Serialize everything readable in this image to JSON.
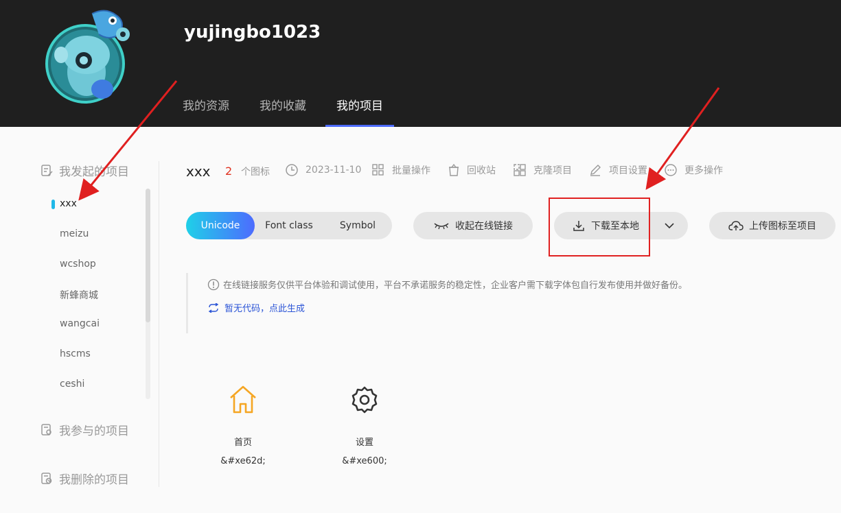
{
  "header": {
    "username": "yujingbo1023",
    "tabs": [
      {
        "label": "我的资源",
        "active": false
      },
      {
        "label": "我的收藏",
        "active": false
      },
      {
        "label": "我的项目",
        "active": true
      }
    ]
  },
  "sidebar": {
    "created_heading": "我发起的项目",
    "projects": [
      "xxx",
      "meizu",
      "wcshop",
      "新蜂商城",
      "wangcai",
      "hscms",
      "ceshi"
    ],
    "active_project": "xxx",
    "joined_heading": "我参与的项目",
    "deleted_heading": "我删除的项目"
  },
  "project": {
    "name": "xxx",
    "icon_count": "2",
    "icon_count_label": "个图标",
    "date": "2023-11-10",
    "actions": {
      "batch": "批量操作",
      "recycle": "回收站",
      "clone": "克隆项目",
      "settings": "项目设置",
      "more": "更多操作"
    }
  },
  "toolbar": {
    "formats": [
      "Unicode",
      "Font class",
      "Symbol"
    ],
    "active_format": "Unicode",
    "collapse_link": "收起在线链接",
    "download": "下载至本地",
    "upload": "上传图标至项目"
  },
  "notice": {
    "text": "在线链接服务仅供平台体验和调试使用，平台不承诺服务的稳定性，企业客户需下载字体包自行发布使用并做好备份。",
    "generate_link": "暂无代码，点此生成"
  },
  "glyphs": [
    {
      "name": "首页",
      "code": "&#xe62d;",
      "icon": "home-icon",
      "color": "#f5a623"
    },
    {
      "name": "设置",
      "code": "&#xe600;",
      "icon": "gear-icon",
      "color": "#333333"
    }
  ],
  "colors": {
    "accent": "#4d6bfe",
    "accent_cyan": "#1fd0e8",
    "annotation_red": "#e02020",
    "count_red": "#e0301e",
    "header_bg": "#1f1f1f"
  }
}
